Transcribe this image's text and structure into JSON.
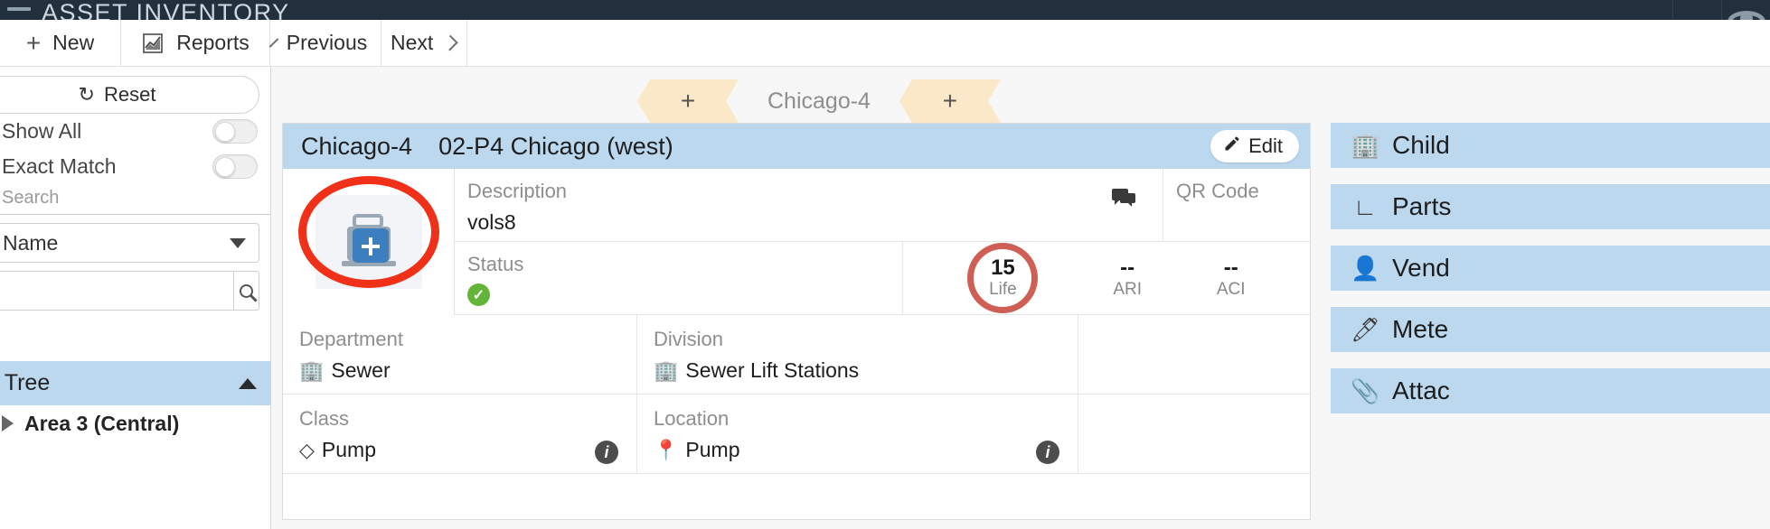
{
  "app": {
    "title": "ASSET INVENTORY",
    "menu_icon": "hamburger-icon",
    "avatar_icon": "user-avatar-icon"
  },
  "toolbar": {
    "new_label": "New",
    "new_icon": "plus-icon",
    "reports_label": "Reports",
    "reports_icon": "chart-icon",
    "previous_label": "Previous",
    "previous_icon": "chevron-left-icon",
    "next_label": "Next",
    "next_icon": "chevron-right-icon"
  },
  "sidebar": {
    "reset_label": "Reset",
    "reset_icon": "refresh-icon",
    "show_all_label": "Show All",
    "show_all_on": false,
    "exact_match_label": "Exact Match",
    "exact_match_on": false,
    "search_section_label": "Search",
    "field_select_value": "Name",
    "search_value": "",
    "search_placeholder": "",
    "search_button_icon": "magnifier-icon",
    "tree_label": "Tree",
    "tree_icon": "tree-icon",
    "tree_items": [
      {
        "label": "Area 3 (Central)",
        "expanded": false
      }
    ]
  },
  "breadcrumb": {
    "left_add_label": "+",
    "current_label": "Chicago-4",
    "right_add_label": "+"
  },
  "card": {
    "title_code": "Chicago-4",
    "title_name": "02-P4 Chicago (west)",
    "edit_label": "Edit",
    "edit_icon": "pencil-icon",
    "thumbnail_icon": "add-image-icon",
    "annotation": "red-oval-highlight",
    "description_label": "Description",
    "description_value": "vols8",
    "comment_icon": "comment-icon",
    "qr_label": "QR Code",
    "qr_value": "",
    "status_label": "Status",
    "status_value": "",
    "status_icon": "check-circle-icon",
    "metrics": [
      {
        "value": "15",
        "label": "Life",
        "highlighted": true
      },
      {
        "value": "--",
        "label": "ARI",
        "highlighted": false
      },
      {
        "value": "--",
        "label": "ACI",
        "highlighted": false
      }
    ],
    "department_label": "Department",
    "department_value": "Sewer",
    "department_icon": "building-icon",
    "division_label": "Division",
    "division_value": "Sewer Lift Stations",
    "division_icon": "building-icon",
    "class_label": "Class",
    "class_value": "Pump",
    "class_icon": "diamond-icon",
    "class_info_icon": "info-icon",
    "location_label": "Location",
    "location_value": "Pump",
    "location_icon": "map-pin-icon",
    "location_info_icon": "info-icon"
  },
  "rail": {
    "items": [
      {
        "label": "Child",
        "icon": "building-icon"
      },
      {
        "label": "Parts",
        "icon": "pipe-icon"
      },
      {
        "label": "Vend",
        "icon": "vendor-icon"
      },
      {
        "label": "Mete",
        "icon": "meter-icon"
      },
      {
        "label": "Attac",
        "icon": "paperclip-icon"
      }
    ]
  },
  "colors": {
    "topbar": "#22303d",
    "accent_blue": "#bcd8ef",
    "crumb": "#fae8c8",
    "annotation_red": "#f03018",
    "ring_red": "#cf5f55",
    "status_green": "#64b43a"
  }
}
